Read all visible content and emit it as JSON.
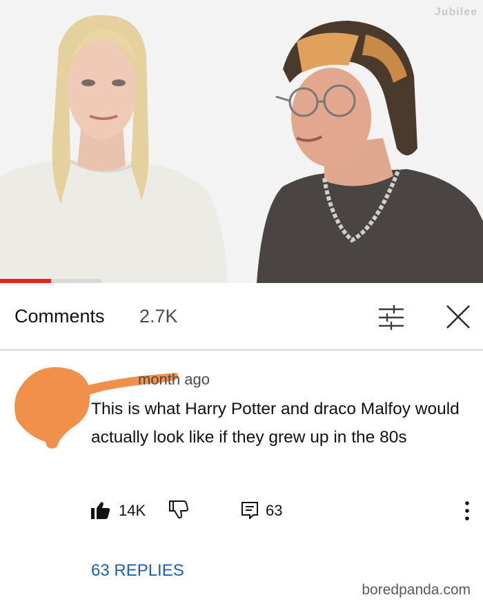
{
  "video": {
    "watermark": "Jubilee",
    "progress_played_fraction": 0.105,
    "progress_buffered_fraction": 0.21
  },
  "comments_header": {
    "title": "Comments",
    "count": "2.7K",
    "sort_icon": "sort-filter-icon",
    "close_icon": "close-icon"
  },
  "comment": {
    "time": "month ago",
    "text": "This is what Harry Potter and draco Malfoy would actually look like if they grew up in the 80s",
    "likes": "14K",
    "replies_count": "63",
    "replies_link": "63 REPLIES",
    "icons": [
      "thumbs-up-icon",
      "thumbs-down-icon",
      "comment-icon",
      "more-vertical-icon"
    ]
  },
  "credit": "boredpanda.com",
  "colors": {
    "progress": "#e62117",
    "link": "#1c5fb4",
    "scribble": "#f0904a"
  }
}
